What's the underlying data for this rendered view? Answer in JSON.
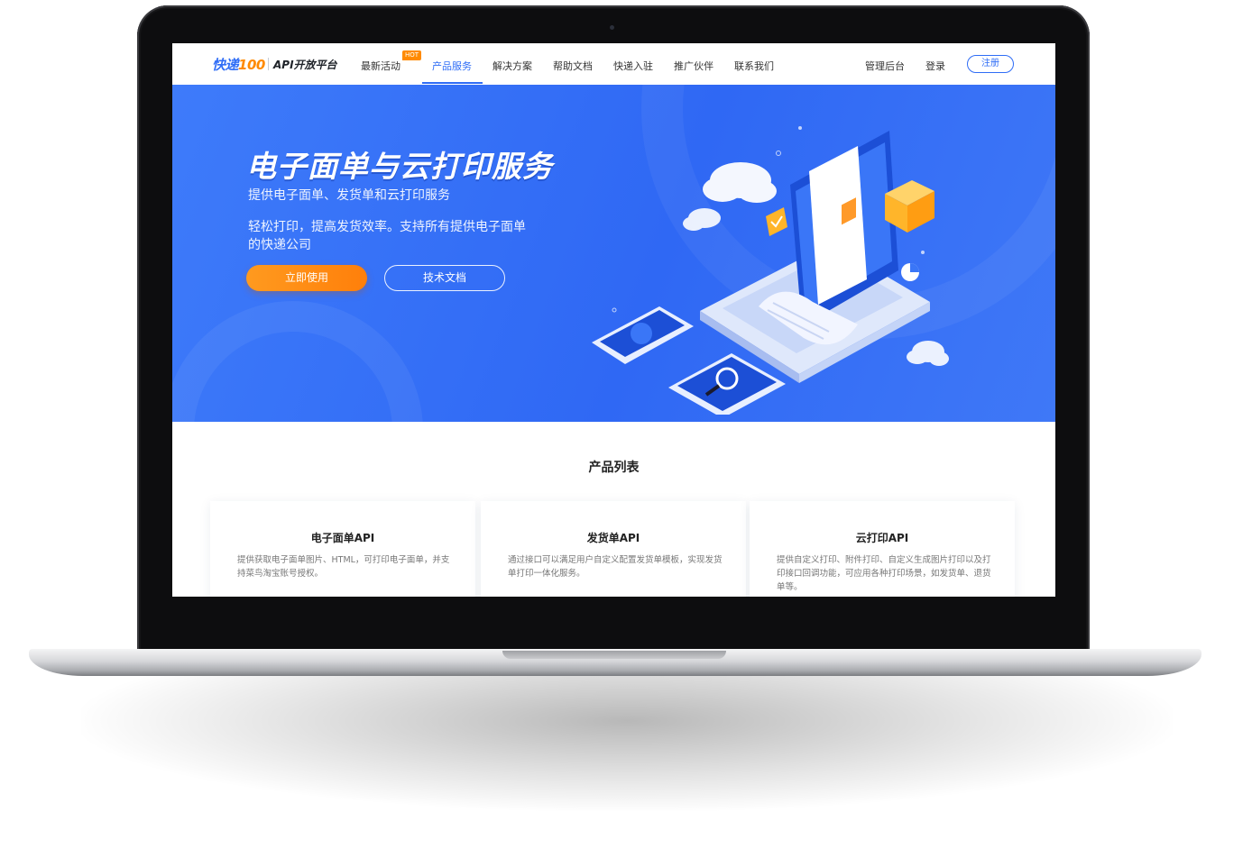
{
  "logo": {
    "brand": "快递",
    "brand_num": "100",
    "platform": "API开放平台"
  },
  "nav": {
    "items": [
      {
        "label": "最新活动",
        "badge": "HOT"
      },
      {
        "label": "产品服务",
        "active": true
      },
      {
        "label": "解决方案"
      },
      {
        "label": "帮助文档"
      },
      {
        "label": "快递入驻"
      },
      {
        "label": "推广伙伴"
      },
      {
        "label": "联系我们"
      }
    ],
    "admin_label": "管理后台",
    "login_label": "登录",
    "register_label": "注册"
  },
  "hero": {
    "title": "电子面单与云打印服务",
    "subtitle": "提供电子面单、发货单和云打印服务",
    "description": "轻松打印，提高发货效率。支持所有提供电子面单的快递公司",
    "primary_button": "立即使用",
    "secondary_button": "技术文档"
  },
  "products": {
    "title": "产品列表",
    "cards": [
      {
        "title": "电子面单API",
        "description": "提供获取电子面单图片、HTML，可打印电子面单，并支持菜鸟淘宝账号授权。"
      },
      {
        "title": "发货单API",
        "description": "通过接口可以满足用户自定义配置发货单模板，实现发货单打印一体化服务。"
      },
      {
        "title": "云打印API",
        "description": "提供自定义打印、附件打印、自定义生成图片打印以及打印接口回调功能，可应用各种打印场景，如发货单、退货单等。"
      }
    ]
  },
  "colors": {
    "brand_blue": "#2f6df6",
    "accent_orange": "#ff8a00",
    "hero_bg": "#3471f6"
  }
}
